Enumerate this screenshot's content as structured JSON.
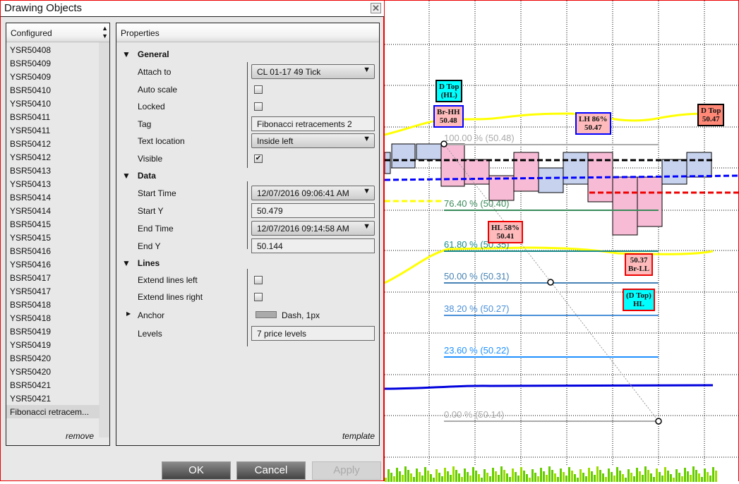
{
  "dialog": {
    "title": "Drawing Objects",
    "close": "✕"
  },
  "list": {
    "header": "Configured",
    "items": [
      "YSR50408",
      "BSR50409",
      "YSR50409",
      "BSR50410",
      "YSR50410",
      "BSR50411",
      "YSR50411",
      "BSR50412",
      "YSR50412",
      "BSR50413",
      "YSR50413",
      "BSR50414",
      "YSR50414",
      "BSR50415",
      "YSR50415",
      "BSR50416",
      "YSR50416",
      "BSR50417",
      "YSR50417",
      "BSR50418",
      "YSR50418",
      "BSR50419",
      "YSR50419",
      "BSR50420",
      "YSR50420",
      "BSR50421",
      "YSR50421",
      "Fibonacci retracem..."
    ],
    "remove": "remove"
  },
  "props": {
    "header": "Properties",
    "template": "template",
    "general": {
      "title": "General",
      "attach_label": "Attach to",
      "attach_value": "CL 01-17 49 Tick",
      "autoscale_label": "Auto scale",
      "autoscale": false,
      "locked_label": "Locked",
      "locked": false,
      "tag_label": "Tag",
      "tag_value": "Fibonacci retracements 2",
      "textloc_label": "Text location",
      "textloc_value": "Inside left",
      "visible_label": "Visible",
      "visible": true
    },
    "data": {
      "title": "Data",
      "start_time_label": "Start Time",
      "start_time": "12/07/2016 09:06:41 AM",
      "start_y_label": "Start Y",
      "start_y": "50.479",
      "end_time_label": "End Time",
      "end_time": "12/07/2016 09:14:58 AM",
      "end_y_label": "End Y",
      "end_y": "50.144"
    },
    "lines": {
      "title": "Lines",
      "ext_left_label": "Extend lines left",
      "ext_left": false,
      "ext_right_label": "Extend lines right",
      "ext_right": false,
      "anchor_label": "Anchor",
      "anchor_value": "Dash, 1px",
      "levels_label": "Levels",
      "levels_value": "7 price levels"
    }
  },
  "buttons": {
    "ok": "OK",
    "cancel": "Cancel",
    "apply": "Apply"
  },
  "chart": {
    "fib_levels": [
      {
        "text": "100.00 % (50.48)",
        "color": "#aaaaaa"
      },
      {
        "text": "76.40 % (50.40)",
        "color": "#3a8a5a"
      },
      {
        "text": "61.80 % (50.35)",
        "color": "#1a8a8a"
      },
      {
        "text": "50.00 % (50.31)",
        "color": "#4682b4"
      },
      {
        "text": "38.20 % (50.27)",
        "color": "#4a90d9"
      },
      {
        "text": "23.60 % (50.22)",
        "color": "#1e90ff"
      },
      {
        "text": "0.00 % (50.14)",
        "color": "#aaaaaa"
      }
    ],
    "labels": [
      {
        "l1": "D Top",
        "l2": "(HL)"
      },
      {
        "l1": "Br-HH",
        "l2": "50.48"
      },
      {
        "l1": "LH 86%",
        "l2": "50.47"
      },
      {
        "l1": "D Top",
        "l2": "50.47"
      },
      {
        "l1": "HL 58%",
        "l2": "50.41"
      },
      {
        "l1": "50.37",
        "l2": "Br-LL"
      },
      {
        "l1": "(D Top)",
        "l2": "HL"
      }
    ]
  }
}
